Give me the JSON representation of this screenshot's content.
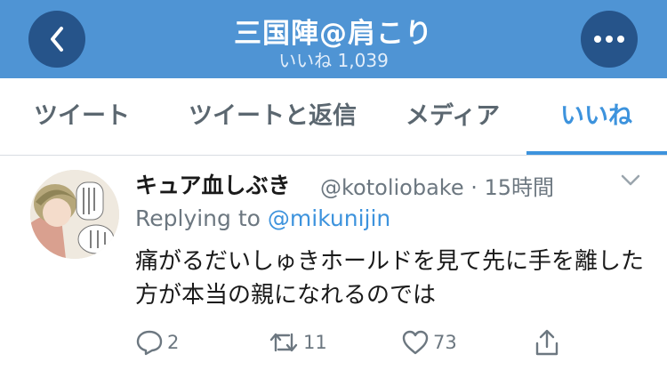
{
  "header": {
    "title": "三国陣@肩こり",
    "subtitle": "いいね 1,039"
  },
  "tabs": [
    {
      "label": "ツイート"
    },
    {
      "label": "ツイートと返信"
    },
    {
      "label": "メディア"
    },
    {
      "label": "いいね",
      "active": true
    }
  ],
  "tweet": {
    "name": "キュア血しぶき",
    "handle_time": "@kotoliobake · 15時間",
    "replying_prefix": "Replying to ",
    "replying_handle": "@mikunijin",
    "text": "痛がるだいしゅきホールドを見て先に手を離した方が本当の親になれるのでは",
    "reply_count": "2",
    "retweet_count": "11",
    "like_count": "73"
  },
  "colors": {
    "header_bg": "#4f94d4",
    "header_button": "#26548a",
    "accent": "#3d93dd",
    "muted": "#6c7780"
  },
  "icons": [
    "chevron-left-icon",
    "more-dots-icon",
    "chevron-down-icon",
    "reply-icon",
    "retweet-icon",
    "heart-icon",
    "share-icon"
  ]
}
